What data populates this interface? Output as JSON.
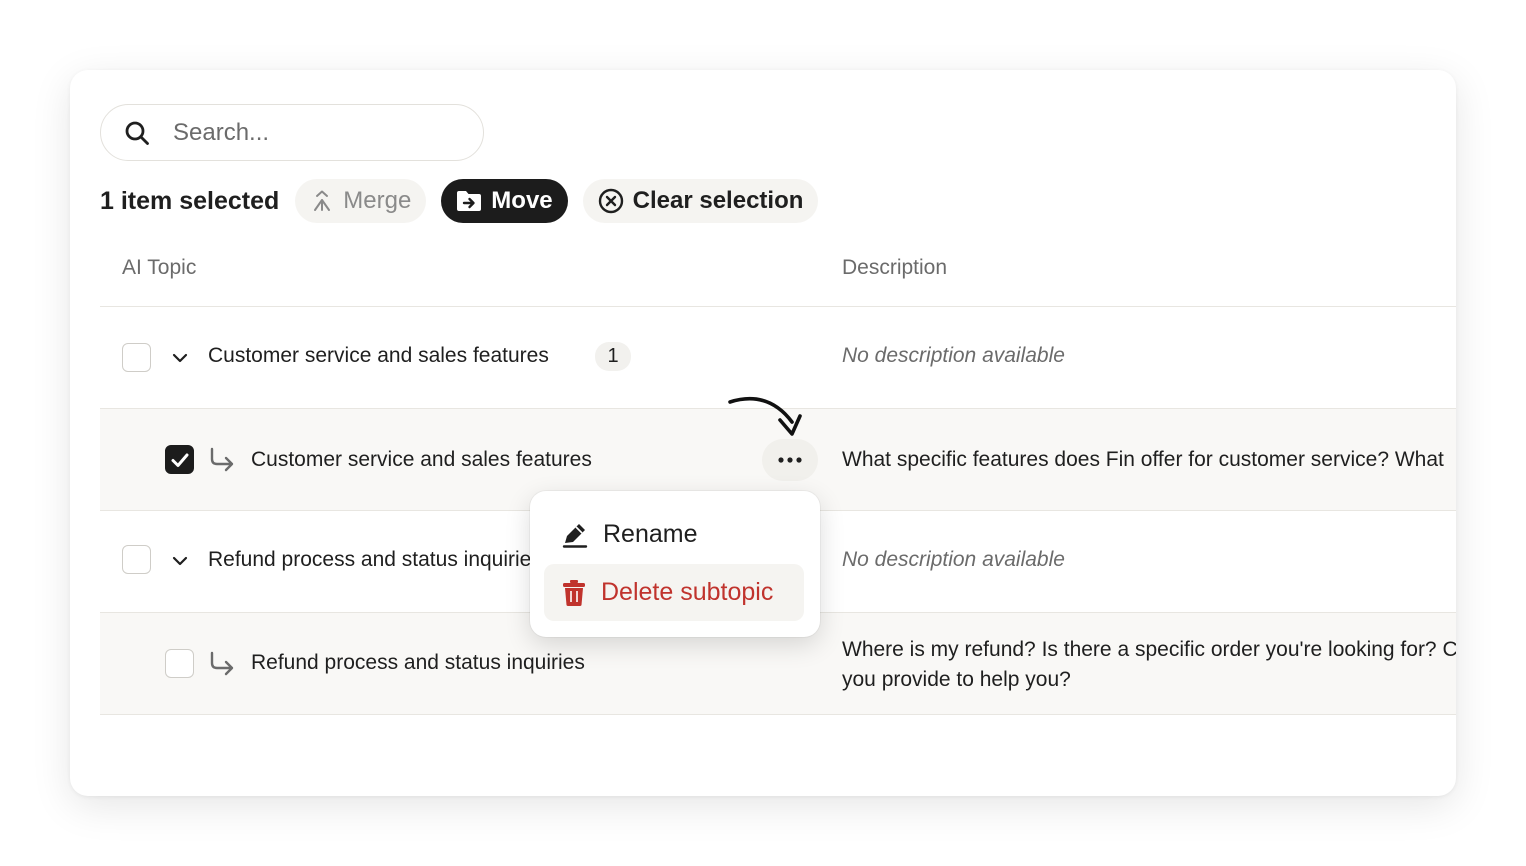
{
  "search": {
    "placeholder": "Search..."
  },
  "toolbar": {
    "selected_label": "1 item selected",
    "merge_label": "Merge",
    "move_label": "Move",
    "clear_label": "Clear selection"
  },
  "table": {
    "columns": [
      "AI Topic",
      "Description"
    ],
    "rows": [
      {
        "kind": "topic",
        "checked": false,
        "label": "Customer service and sales features",
        "count": "1",
        "description": "No description available"
      },
      {
        "kind": "subtopic",
        "checked": true,
        "label": "Customer service and sales features",
        "description": "What specific features does Fin offer for customer service? What"
      },
      {
        "kind": "topic",
        "checked": false,
        "label": "Refund process and status inquiries",
        "description": "No description available"
      },
      {
        "kind": "subtopic",
        "checked": false,
        "label": "Refund process and status inquiries",
        "description": "Where is my refund? Is there a specific order you're looking for? Can you provide to help you?"
      }
    ]
  },
  "menu": {
    "rename_label": "Rename",
    "delete_label": "Delete subtopic"
  },
  "colors": {
    "accent_dark": "#1c1c1c",
    "danger": "#c0332d",
    "muted_text": "#6b6b6b",
    "pill_bg": "#f5f4f1"
  }
}
